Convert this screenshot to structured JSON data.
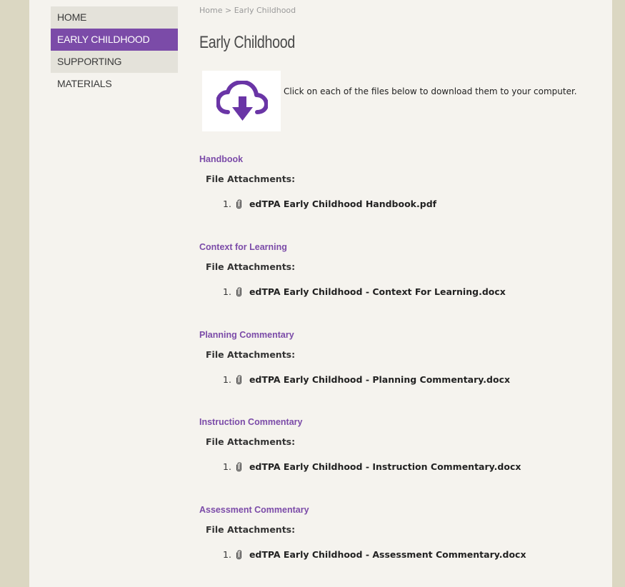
{
  "nav": {
    "items": [
      {
        "label": "HOME",
        "active": false
      },
      {
        "label": "EARLY CHILDHOOD",
        "active": true
      },
      {
        "label": "SUPPORTING MATERIALS",
        "active": false
      }
    ]
  },
  "breadcrumb": {
    "home": "Home",
    "separator": ">",
    "current": "Early Childhood"
  },
  "page": {
    "title": "Early Childhood",
    "intro": "Click on each of the files below to download them to your computer.",
    "download_icon": "cloud-download-icon"
  },
  "sections": [
    {
      "title": "Handbook",
      "attachments_label": "File Attachments:",
      "files": [
        {
          "num": "1.",
          "name": "edTPA Early Childhood Handbook.pdf"
        }
      ]
    },
    {
      "title": "Context for Learning",
      "attachments_label": "File Attachments:",
      "files": [
        {
          "num": "1.",
          "name": "edTPA Early Childhood - Context For Learning.docx"
        }
      ]
    },
    {
      "title": "Planning Commentary",
      "attachments_label": "File Attachments:",
      "files": [
        {
          "num": "1.",
          "name": "edTPA Early Childhood - Planning Commentary.docx"
        }
      ]
    },
    {
      "title": "Instruction Commentary",
      "attachments_label": "File Attachments:",
      "files": [
        {
          "num": "1.",
          "name": "edTPA Early Childhood - Instruction Commentary.docx"
        }
      ]
    },
    {
      "title": "Assessment Commentary",
      "attachments_label": "File Attachments:",
      "files": [
        {
          "num": "1.",
          "name": "edTPA Early Childhood - Assessment Commentary.docx"
        }
      ]
    }
  ],
  "colors": {
    "accent": "#7b4ba8",
    "side_panel": "#dbd7c2",
    "page_bg": "#f5f3ee"
  }
}
